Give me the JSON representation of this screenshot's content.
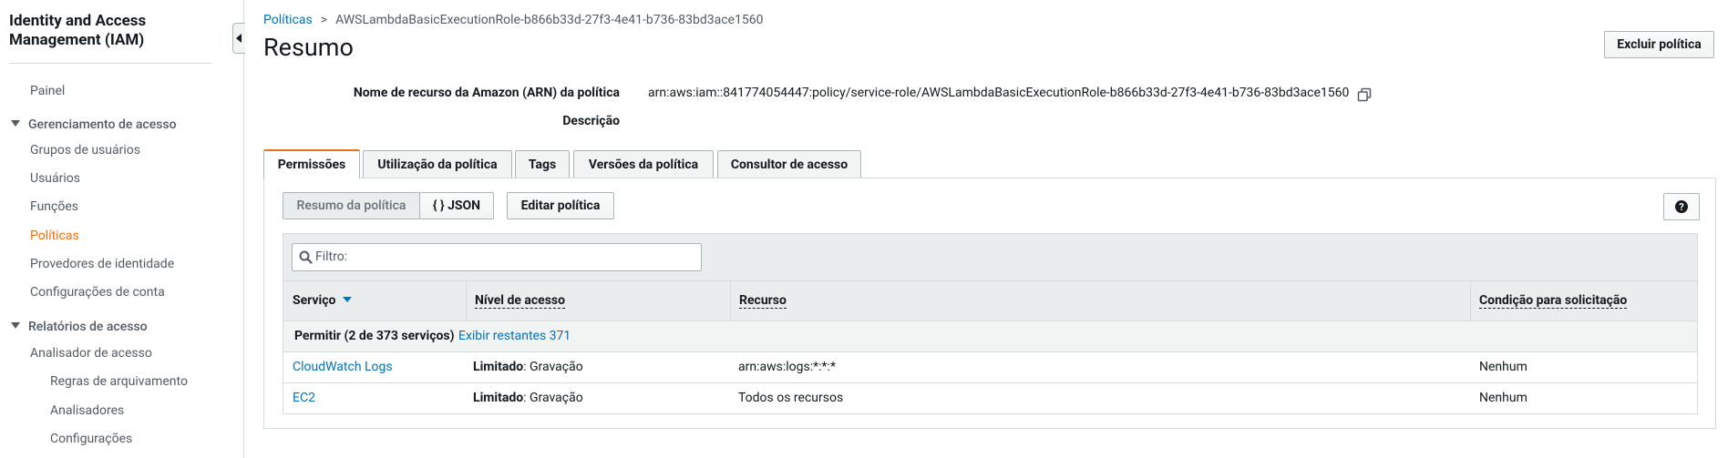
{
  "sidebar": {
    "title": "Identity and Access Management (IAM)",
    "items": {
      "painel": "Painel",
      "section_access": "Gerenciamento de acesso",
      "grupos": "Grupos de usuários",
      "usuarios": "Usuários",
      "funcoes": "Funções",
      "politicas": "Políticas",
      "provedores": "Provedores de identidade",
      "config_conta": "Configurações de conta",
      "section_reports": "Relatórios de acesso",
      "analisador": "Analisador de acesso",
      "regras": "Regras de arquivamento",
      "analisadores": "Analisadores",
      "configuracoes": "Configurações"
    }
  },
  "breadcrumb": {
    "parent": "Políticas",
    "separator": ">",
    "current": "AWSLambdaBasicExecutionRole-b866b33d-27f3-4e41-b736-83bd3ace1560"
  },
  "page": {
    "title": "Resumo",
    "delete_button": "Excluir política"
  },
  "details": {
    "arn_label": "Nome de recurso da Amazon (ARN) da política",
    "arn_value": "arn:aws:iam::841774054447:policy/service-role/AWSLambdaBasicExecutionRole-b866b33d-27f3-4e41-b736-83bd3ace1560",
    "description_label": "Descrição"
  },
  "tabs": [
    "Permissões",
    "Utilização da política",
    "Tags",
    "Versões da política",
    "Consultor de acesso"
  ],
  "toolbar": {
    "summary_button": "Resumo da política",
    "json_button": "{ } JSON",
    "edit_button": "Editar política",
    "help_icon": "?"
  },
  "filter": {
    "placeholder": "Filtro:"
  },
  "table": {
    "headers": [
      "Serviço",
      "Nível de acesso",
      "Recurso",
      "Condição para solicitação"
    ],
    "group": {
      "label": "Permitir (2 de 373 serviços)",
      "link": "Exibir restantes 371"
    },
    "rows": [
      {
        "service": "CloudWatch Logs",
        "level": "Limitado",
        "level_detail": ": Gravação",
        "resource": "arn:aws:logs:*:*:*",
        "condition": "Nenhum"
      },
      {
        "service": "EC2",
        "level": "Limitado",
        "level_detail": ": Gravação",
        "resource": "Todos os recursos",
        "condition": "Nenhum"
      }
    ]
  },
  "colors": {
    "link": "#0073bb",
    "active": "#ec7211",
    "text": "#16191f"
  }
}
